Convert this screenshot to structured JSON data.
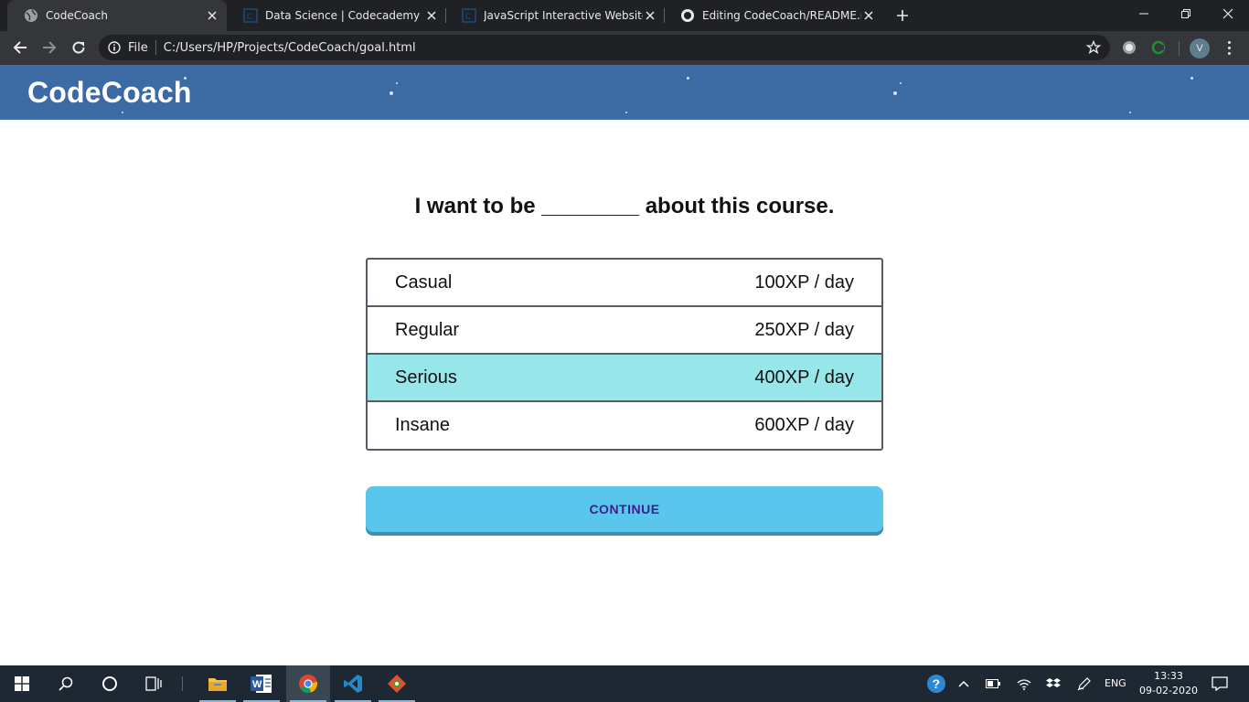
{
  "browser": {
    "tabs": [
      {
        "title": "CodeCoach",
        "icon": "globe-icon",
        "active": true
      },
      {
        "title": "Data Science | Codecademy",
        "icon": "codecademy-icon",
        "active": false
      },
      {
        "title": "JavaScript Interactive Websites | C",
        "icon": "codecademy-icon",
        "active": false
      },
      {
        "title": "Editing CodeCoach/README.md",
        "icon": "github-icon",
        "active": false
      }
    ],
    "scheme_label": "File",
    "url": "C:/Users/HP/Projects/CodeCoach/goal.html",
    "profile_initial": "V"
  },
  "app": {
    "logo": "CodeCoach",
    "header_color": "#3c6aa3"
  },
  "goal": {
    "question": "I want to be ________ about this course.",
    "options": [
      {
        "label": "Casual",
        "xp": "100XP / day",
        "selected": false
      },
      {
        "label": "Regular",
        "xp": "250XP / day",
        "selected": false
      },
      {
        "label": "Serious",
        "xp": "400XP / day",
        "selected": true
      },
      {
        "label": "Insane",
        "xp": "600XP / day",
        "selected": false
      }
    ],
    "selected_color": "#97e7ea",
    "continue_label": "CONTINUE",
    "continue_color": "#5bc6ec"
  },
  "taskbar": {
    "apps": [
      "start-icon",
      "search-icon",
      "cortana-icon",
      "task-view-icon",
      "file-explorer-icon",
      "word-icon",
      "chrome-icon",
      "vscode-icon",
      "git-icon"
    ],
    "language": "ENG",
    "time": "13:33",
    "date": "09-02-2020"
  }
}
